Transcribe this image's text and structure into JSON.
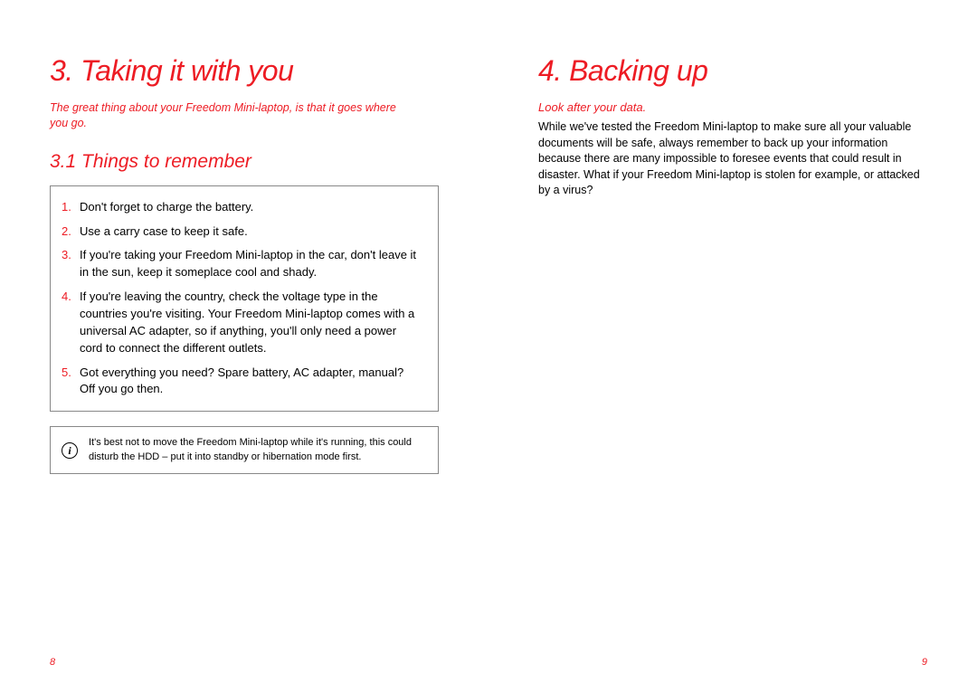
{
  "left": {
    "heading": "3. Taking it with you",
    "intro": "The great thing about your Freedom Mini-laptop, is that it goes where you go.",
    "subheading": "3.1 Things to remember",
    "list": [
      "Don't forget to charge the battery.",
      "Use a carry case to keep it safe.",
      "If you're taking your Freedom Mini-laptop in the car, don't leave it in the sun, keep it someplace cool and shady.",
      "If you're leaving the country, check the voltage type in the countries you're visiting. Your Freedom Mini-laptop comes with a universal AC adapter, so if anything, you'll only need a power cord to connect the different outlets.",
      "Got everything you need? Spare battery, AC adapter, manual? Off you go then."
    ],
    "note_icon": "i",
    "note": "It's best not to move the Freedom Mini-laptop while it's running, this could disturb the HDD – put it into standby or hibernation mode first.",
    "page_num": "8"
  },
  "right": {
    "heading": "4. Backing up",
    "sub_intro": "Look after your data.",
    "body": "While we've tested the Freedom Mini-laptop to make sure all your valuable documents will be safe, always remember to back up your information because there are many impossible to foresee events that could result in disaster. What if your Freedom Mini-laptop is stolen for example, or attacked by a virus?",
    "page_num": "9"
  }
}
